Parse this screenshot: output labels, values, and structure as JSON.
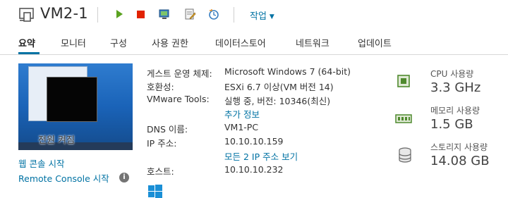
{
  "header": {
    "title": "VM2-1",
    "actions_label": "작업"
  },
  "tabs": [
    {
      "label": "요약"
    },
    {
      "label": "모니터"
    },
    {
      "label": "구성"
    },
    {
      "label": "사용 권한"
    },
    {
      "label": "데이터스토어"
    },
    {
      "label": "네트워크"
    },
    {
      "label": "업데이트"
    }
  ],
  "console": {
    "overlay_text": "전원 켜짐",
    "web_console": "웹 콘솔 시작",
    "remote_console": "Remote Console 시작",
    "info_glyph": "i"
  },
  "details": {
    "guest_os_label": "게스트 운영 체제:",
    "guest_os_value": "Microsoft Windows 7 (64-bit)",
    "compat_label": "호환성:",
    "compat_value": "ESXi 6.7 이상(VM 버전 14)",
    "tools_label": "VMware Tools:",
    "tools_value": "실행 중, 버전: 10346(최신)",
    "more_info": "추가 정보",
    "dns_label": "DNS 이름:",
    "dns_value": "VM1-PC",
    "ip_label": "IP 주소:",
    "ip_value": "10.10.10.159",
    "all_ips": "모든 2 IP 주소 보기",
    "host_label": "호스트:",
    "host_value": "10.10.10.232"
  },
  "resources": {
    "cpu_label": "CPU 사용량",
    "cpu_value": "3.3 GHz",
    "mem_label": "메모리 사용량",
    "mem_value": "1.5 GB",
    "storage_label": "스토리지 사용량",
    "storage_value": "14.08 GB"
  },
  "colors": {
    "link": "#0072a3",
    "play": "#5aa220",
    "stop": "#e12200",
    "resource_icon": "#4f8a2e"
  }
}
